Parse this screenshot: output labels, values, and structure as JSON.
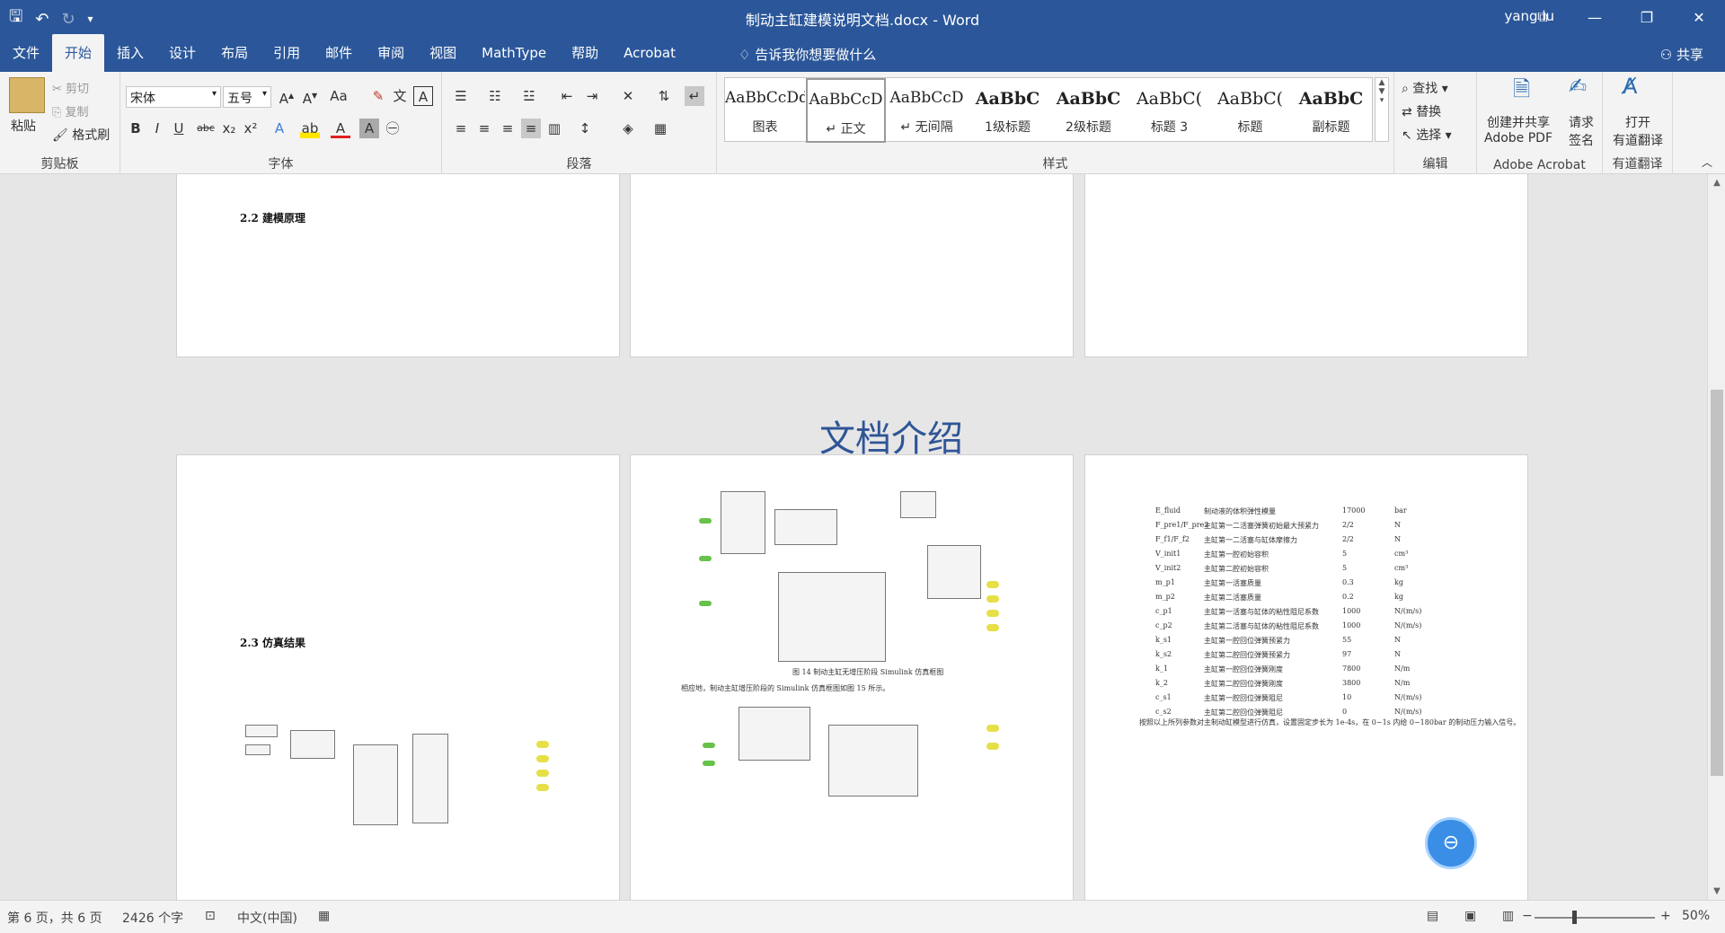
{
  "window": {
    "title": "制动主缸建模说明文档.docx  -  Word",
    "user": "yang lu",
    "controls": [
      "⧉",
      "—",
      "❐",
      "✕"
    ]
  },
  "quick_access": {
    "save_icon": "save-icon",
    "undo_icon": "undo-icon",
    "redo_icon": "redo-icon",
    "customize_icon": "customize-icon"
  },
  "tabs": [
    "文件",
    "开始",
    "插入",
    "设计",
    "布局",
    "引用",
    "邮件",
    "审阅",
    "视图",
    "MathType",
    "帮助",
    "Acrobat"
  ],
  "active_tab": "开始",
  "tellme": "告诉我你想要做什么",
  "share": "共享",
  "clipboard": {
    "paste": "粘贴",
    "cut": "剪切",
    "copy": "复制",
    "format_painter": "格式刷",
    "label": "剪贴板"
  },
  "font": {
    "name": "宋体",
    "size": "五号",
    "label": "字体"
  },
  "paragraph": {
    "label": "段落"
  },
  "styles": {
    "label": "样式",
    "items": [
      {
        "sample": "AaBbCcDdE",
        "name": "图表"
      },
      {
        "sample": "AaBbCcD",
        "name": "↵ 正文"
      },
      {
        "sample": "AaBbCcD",
        "name": "↵ 无间隔"
      },
      {
        "sample": "AaBbC",
        "name": "1级标题"
      },
      {
        "sample": "AaBbC",
        "name": "2级标题"
      },
      {
        "sample": "AaBbC(",
        "name": "标题 3"
      },
      {
        "sample": "AaBbC(",
        "name": "标题"
      },
      {
        "sample": "AaBbC",
        "name": "副标题"
      }
    ]
  },
  "editing": {
    "find": "查找",
    "replace": "替换",
    "select": "选择",
    "label": "编辑"
  },
  "acrobat": {
    "create_share": "创建并共享",
    "create_share_2": "Adobe PDF",
    "request_sign": "请求",
    "request_sign_2": "签名",
    "label": "Adobe Acrobat"
  },
  "translate": {
    "open": "打开",
    "open_2": "有道翻译",
    "label": "有道翻译"
  },
  "document": {
    "overlay_title": "文档介绍",
    "page1_heading": "2.2 建模原理",
    "page4_heading": "2.3 仿真结果",
    "page5_caption": "图 14 制动主缸无增压阶段 Simulink 仿真框图",
    "page5_body": "相应地，制动主缸增压阶段的 Simulink 仿真框图如图 15 所示。",
    "page6_footer": "按照以上所列参数对主制动缸模型进行仿真，设置固定步长为 1e-4s，在 0~1s 内给 0~180bar 的制动压力输入信号。",
    "table_rows": [
      [
        "E_fluid",
        "制动液的体积弹性模量",
        "17000",
        "bar"
      ],
      [
        "F_pre1/F_pre2",
        "主缸第一二活塞弹簧初始最大预紧力",
        "2/2",
        "N"
      ],
      [
        "F_f1/F_f2",
        "主缸第一二活塞与缸体摩擦力",
        "2/2",
        "N"
      ],
      [
        "V_init1",
        "主缸第一腔初始容积",
        "5",
        "cm³"
      ],
      [
        "V_init2",
        "主缸第二腔初始容积",
        "5",
        "cm³"
      ],
      [
        "m_p1",
        "主缸第一活塞质量",
        "0.3",
        "kg"
      ],
      [
        "m_p2",
        "主缸第二活塞质量",
        "0.2",
        "kg"
      ],
      [
        "c_p1",
        "主缸第一活塞与缸体的粘性阻尼系数",
        "1000",
        "N/(m/s)"
      ],
      [
        "c_p2",
        "主缸第二活塞与缸体的粘性阻尼系数",
        "1000",
        "N/(m/s)"
      ],
      [
        "k_s1",
        "主缸第一腔回位弹簧预紧力",
        "55",
        "N"
      ],
      [
        "k_s2",
        "主缸第二腔回位弹簧预紧力",
        "97",
        "N"
      ],
      [
        "k_1",
        "主缸第一腔回位弹簧刚度",
        "7800",
        "N/m"
      ],
      [
        "k_2",
        "主缸第二腔回位弹簧刚度",
        "3800",
        "N/m"
      ],
      [
        "c_s1",
        "主缸第一腔回位弹簧阻尼",
        "10",
        "N/(m/s)"
      ],
      [
        "c_s2",
        "主缸第二腔回位弹簧阻尼",
        "0",
        "N/(m/s)"
      ]
    ]
  },
  "status": {
    "page": "第 6 页，共 6 页",
    "words": "2426 个字",
    "language": "中文(中国)",
    "zoom": "50%"
  }
}
